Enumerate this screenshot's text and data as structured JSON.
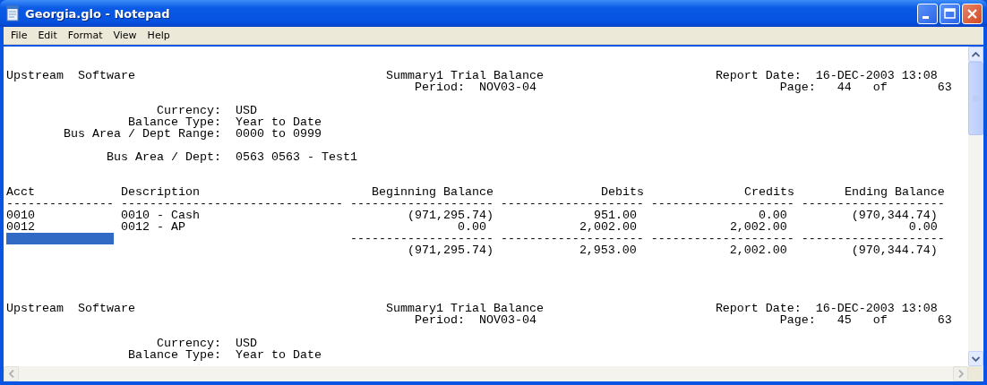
{
  "window": {
    "title": "Georgia.glo - Notepad"
  },
  "menu": [
    "File",
    "Edit",
    "Format",
    "View",
    "Help"
  ],
  "lines": [
    {
      "kind": "blank"
    },
    {
      "kind": "blank"
    },
    {
      "kind": "text",
      "text": "Upstream  Software                                   Summary1 Trial Balance                        Report Date:  16-DEC-2003 13:08"
    },
    {
      "kind": "text",
      "text": "                                                         Period:  NOV03-04                                  Page:   44   of       63"
    },
    {
      "kind": "blank"
    },
    {
      "kind": "text",
      "text": "                     Currency:  USD"
    },
    {
      "kind": "text",
      "text": "                 Balance Type:  Year to Date"
    },
    {
      "kind": "text",
      "text": "        Bus Area / Dept Range:  0000 to 0999"
    },
    {
      "kind": "blank"
    },
    {
      "kind": "text",
      "text": "              Bus Area / Dept:  0563 0563 - Test1"
    },
    {
      "kind": "blank"
    },
    {
      "kind": "blank"
    },
    {
      "kind": "text",
      "text": "Acct            Description                        Beginning Balance               Debits              Credits       Ending Balance"
    },
    {
      "kind": "text",
      "text": "--------------- ------------------------------- -------------------- -------------------- -------------------- --------------------"
    },
    {
      "kind": "text",
      "text": "0010            0010 - Cash                             (971,295.74)              951.00                 0.00         (970,344.74)"
    },
    {
      "kind": "text",
      "text": "0012            0012 - AP                                      0.00             2,002.00             2,002.00                 0.00"
    },
    {
      "kind": "text",
      "selected": true,
      "text": "                                                -------------------- -------------------- -------------------- --------------------"
    },
    {
      "kind": "text",
      "text": "                                                        (971,295.74)            2,953.00             2,002.00         (970,344.74)"
    },
    {
      "kind": "blank"
    },
    {
      "kind": "blank"
    },
    {
      "kind": "blank"
    },
    {
      "kind": "blank"
    },
    {
      "kind": "text",
      "text": "Upstream  Software                                   Summary1 Trial Balance                        Report Date:  16-DEC-2003 13:08"
    },
    {
      "kind": "text",
      "text": "                                                         Period:  NOV03-04                                  Page:   45   of       63"
    },
    {
      "kind": "blank"
    },
    {
      "kind": "text",
      "text": "                     Currency:  USD"
    },
    {
      "kind": "text",
      "text": "                 Balance Type:  Year to Date"
    }
  ]
}
